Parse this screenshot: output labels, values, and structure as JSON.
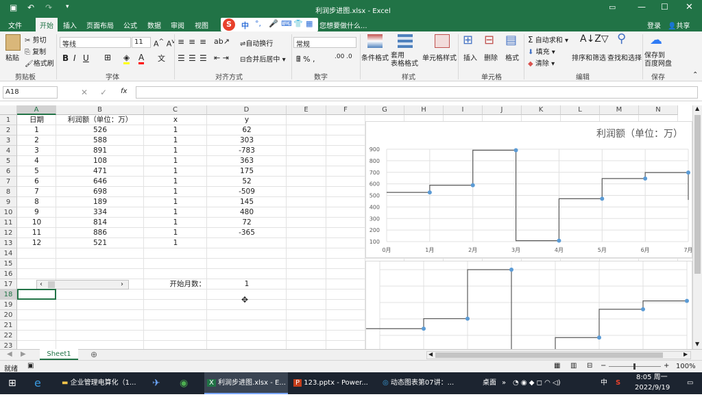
{
  "title_bar": {
    "title": "利润步进图.xlsx - Excel"
  },
  "ribbon_tabs": [
    "文件",
    "开始",
    "插入",
    "页面布局",
    "公式",
    "数据",
    "审阅",
    "视图"
  ],
  "tell_me": "您想要做什么...",
  "user": {
    "signin": "登录",
    "share": "共享"
  },
  "ribbon": {
    "clipboard": {
      "paste": "粘贴",
      "cut": "剪切",
      "copy": "复制",
      "format_painter": "格式刷",
      "label": "剪贴板"
    },
    "font": {
      "name": "等线",
      "size": "11",
      "label": "字体"
    },
    "alignment": {
      "wrap": "自动换行",
      "merge": "合并后居中",
      "label": "对齐方式"
    },
    "number": {
      "format": "常规",
      "label": "数字"
    },
    "styles": {
      "conditional": "条件格式",
      "table": "套用\n表格格式",
      "cell": "单元格样式",
      "label": "样式"
    },
    "cells": {
      "insert": "插入",
      "delete": "删除",
      "format": "格式",
      "label": "单元格"
    },
    "editing": {
      "autosum": "自动求和",
      "fill": "填充",
      "clear": "清除",
      "sort": "排序和筛选",
      "find": "查找和选择",
      "label": "编辑"
    },
    "save": {
      "button": "保存到\n百度网盘",
      "label": "保存"
    }
  },
  "formula_bar": {
    "name_box": "A18",
    "fx": "fx",
    "formula": ""
  },
  "columns": [
    "A",
    "B",
    "C",
    "D",
    "E",
    "F",
    "G",
    "H",
    "I",
    "J",
    "K",
    "L",
    "M",
    "N"
  ],
  "rows": [
    "1",
    "2",
    "3",
    "4",
    "5",
    "6",
    "7",
    "8",
    "9",
    "10",
    "11",
    "12",
    "13",
    "14",
    "15",
    "16",
    "17",
    "18",
    "19",
    "20",
    "21",
    "22",
    "23"
  ],
  "table": {
    "headers": [
      "日期",
      "利润额（单位：万）",
      "x",
      "y"
    ],
    "data": [
      [
        "1",
        "526",
        "1",
        "62"
      ],
      [
        "2",
        "588",
        "1",
        "303"
      ],
      [
        "3",
        "891",
        "1",
        "-783"
      ],
      [
        "4",
        "108",
        "1",
        "363"
      ],
      [
        "5",
        "471",
        "1",
        "175"
      ],
      [
        "6",
        "646",
        "1",
        "52"
      ],
      [
        "7",
        "698",
        "1",
        "-509"
      ],
      [
        "8",
        "189",
        "1",
        "145"
      ],
      [
        "9",
        "334",
        "1",
        "480"
      ],
      [
        "10",
        "814",
        "1",
        "72"
      ],
      [
        "11",
        "886",
        "1",
        "-365"
      ],
      [
        "12",
        "521",
        "1",
        ""
      ]
    ]
  },
  "start_month": {
    "label": "开始月数：",
    "value": "1"
  },
  "chart_data": [
    {
      "type": "line",
      "title": "利润额（单位：万）",
      "step": true,
      "x": [
        "0月",
        "1月",
        "2月",
        "3月",
        "4月",
        "5月",
        "6月",
        "7月"
      ],
      "points": [
        526,
        588,
        891,
        108,
        471,
        646,
        698
      ],
      "series": [
        {
          "name": "",
          "values": [
            526,
            588,
            891,
            108,
            471,
            646,
            698
          ]
        }
      ],
      "ylim": [
        100,
        900
      ],
      "yticks": [
        "100",
        "200",
        "300",
        "400",
        "500",
        "600",
        "700",
        "800",
        "900"
      ],
      "grid": true,
      "color": "#5b9bd5",
      "line_color": "#595959"
    },
    {
      "type": "line",
      "step": true,
      "series": [
        {
          "name": "",
          "values": [
            526,
            588,
            891,
            108,
            471,
            646,
            698
          ]
        }
      ],
      "grid": true
    }
  ],
  "sheet_tabs": [
    "Sheet1"
  ],
  "status": {
    "mode": "就绪",
    "zoom": "100%"
  },
  "taskbar": {
    "items": [
      "企业管理电算化（1...",
      "利润步进图.xlsx - E...",
      "123.pptx - Power...",
      "动态图表第07讲：..."
    ],
    "desktop": "桌面",
    "ime": "中",
    "time": "8:05 周一",
    "date": "2022/9/19"
  },
  "colors": {
    "excel_green": "#217346",
    "series_marker": "#5b9bd5"
  }
}
